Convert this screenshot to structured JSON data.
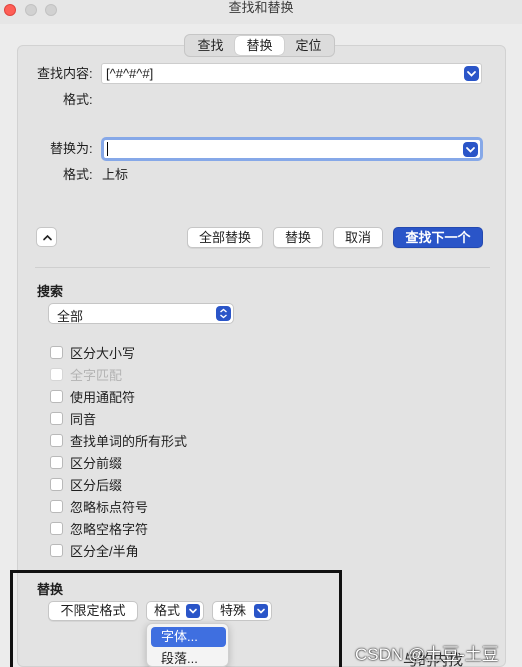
{
  "window": {
    "title": "查找和替换"
  },
  "tabs": [
    {
      "label": "查找",
      "active": false
    },
    {
      "label": "替换",
      "active": true
    },
    {
      "label": "定位",
      "active": false
    }
  ],
  "find": {
    "label": "查找内容:",
    "value": "[^#^#^#]",
    "format_label": "格式:",
    "format_value": ""
  },
  "replace": {
    "label": "替换为:",
    "value": "",
    "format_label": "格式:",
    "format_value": "上标"
  },
  "buttons": {
    "replace_all": "全部替换",
    "replace": "替换",
    "cancel": "取消",
    "find_next": "查找下一个"
  },
  "search": {
    "title": "搜索",
    "scope_value": "全部",
    "options": [
      {
        "label": "区分大小写",
        "enabled": true,
        "checked": false
      },
      {
        "label": "全字匹配",
        "enabled": false,
        "checked": false
      },
      {
        "label": "使用通配符",
        "enabled": true,
        "checked": false
      },
      {
        "label": "同音",
        "enabled": true,
        "checked": false
      },
      {
        "label": "查找单词的所有形式",
        "enabled": true,
        "checked": false
      },
      {
        "label": "区分前缀",
        "enabled": true,
        "checked": false
      },
      {
        "label": "区分后缀",
        "enabled": true,
        "checked": false
      },
      {
        "label": "忽略标点符号",
        "enabled": true,
        "checked": false
      },
      {
        "label": "忽略空格字符",
        "enabled": true,
        "checked": false
      },
      {
        "label": "区分全/半角",
        "enabled": true,
        "checked": false
      }
    ]
  },
  "replace_section": {
    "title": "替换",
    "no_format": "不限定格式",
    "format": "格式",
    "special": "特殊"
  },
  "format_menu": {
    "items": [
      "字体...",
      "段落..."
    ],
    "selected_index": 0
  },
  "background_text": "与的内找",
  "watermark": "CSDN @土豆-土豆",
  "colors": {
    "accent": "#2a55c8",
    "menu_highlight": "#3f6fe0",
    "close": "#fe5f57"
  }
}
